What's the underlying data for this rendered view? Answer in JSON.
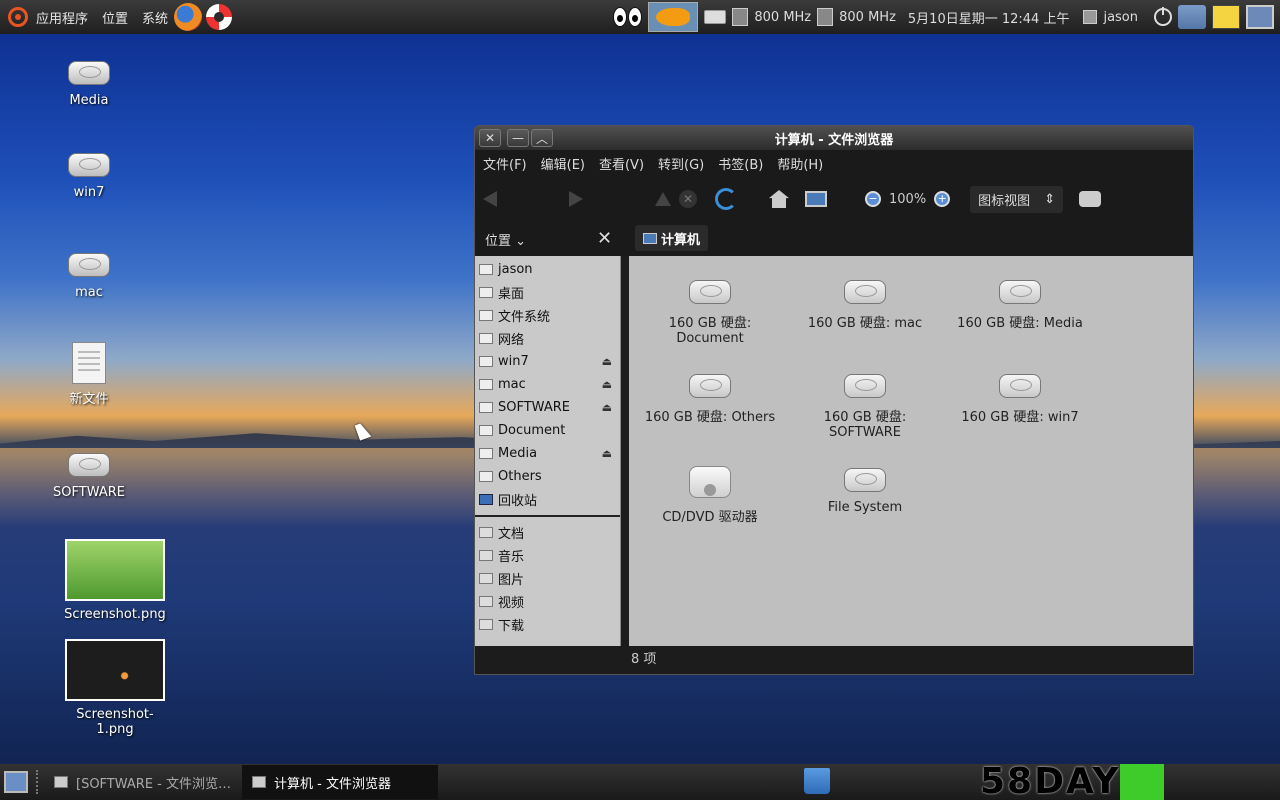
{
  "top_panel": {
    "menus": [
      "应用程序",
      "位置",
      "系统"
    ],
    "cpu1": "800 MHz",
    "cpu2": "800 MHz",
    "datetime": "5月10日星期一 12:44 上午",
    "user": "jason"
  },
  "desktop": {
    "icons": [
      "Media",
      "win7",
      "mac",
      "新文件",
      "SOFTWARE",
      "Screenshot.png",
      "Screenshot-1.png"
    ]
  },
  "window": {
    "title": "计算机 - 文件浏览器",
    "menu": [
      "文件(F)",
      "编辑(E)",
      "查看(V)",
      "转到(G)",
      "书签(B)",
      "帮助(H)"
    ],
    "toolbar": {
      "zoom": "100%",
      "view_mode": "图标视图"
    },
    "places_label": "位置",
    "breadcrumb": "计算机",
    "sidebar": {
      "devices": [
        {
          "label": "jason",
          "eject": false
        },
        {
          "label": "桌面",
          "eject": false
        },
        {
          "label": "文件系统",
          "eject": false
        },
        {
          "label": "网络",
          "eject": false
        },
        {
          "label": "win7",
          "eject": true
        },
        {
          "label": "mac",
          "eject": true
        },
        {
          "label": "SOFTWARE",
          "eject": true
        },
        {
          "label": "Document",
          "eject": false
        },
        {
          "label": "Media",
          "eject": true
        },
        {
          "label": "Others",
          "eject": false
        },
        {
          "label": "回收站",
          "eject": false
        }
      ],
      "bookmarks": [
        "文档",
        "音乐",
        "图片",
        "视频",
        "下载"
      ]
    },
    "files": [
      {
        "line1": "160 GB 硬盘:",
        "line2": "Document",
        "type": "hdd"
      },
      {
        "line1": "160 GB 硬盘: mac",
        "line2": "",
        "type": "hdd"
      },
      {
        "line1": "160 GB 硬盘: Media",
        "line2": "",
        "type": "hdd"
      },
      {
        "line1": "160 GB 硬盘: Others",
        "line2": "",
        "type": "hdd"
      },
      {
        "line1": "160 GB 硬盘:",
        "line2": "SOFTWARE",
        "type": "hdd"
      },
      {
        "line1": "160 GB 硬盘: win7",
        "line2": "",
        "type": "hdd"
      },
      {
        "line1": "CD/DVD 驱动器",
        "line2": "",
        "type": "cd"
      },
      {
        "line1": "File System",
        "line2": "",
        "type": "hdd"
      }
    ],
    "status": "8 项"
  },
  "taskbar": {
    "tasks": [
      "[SOFTWARE - 文件浏览…",
      "计算机 - 文件浏览器"
    ],
    "watermark": "58DAY"
  }
}
